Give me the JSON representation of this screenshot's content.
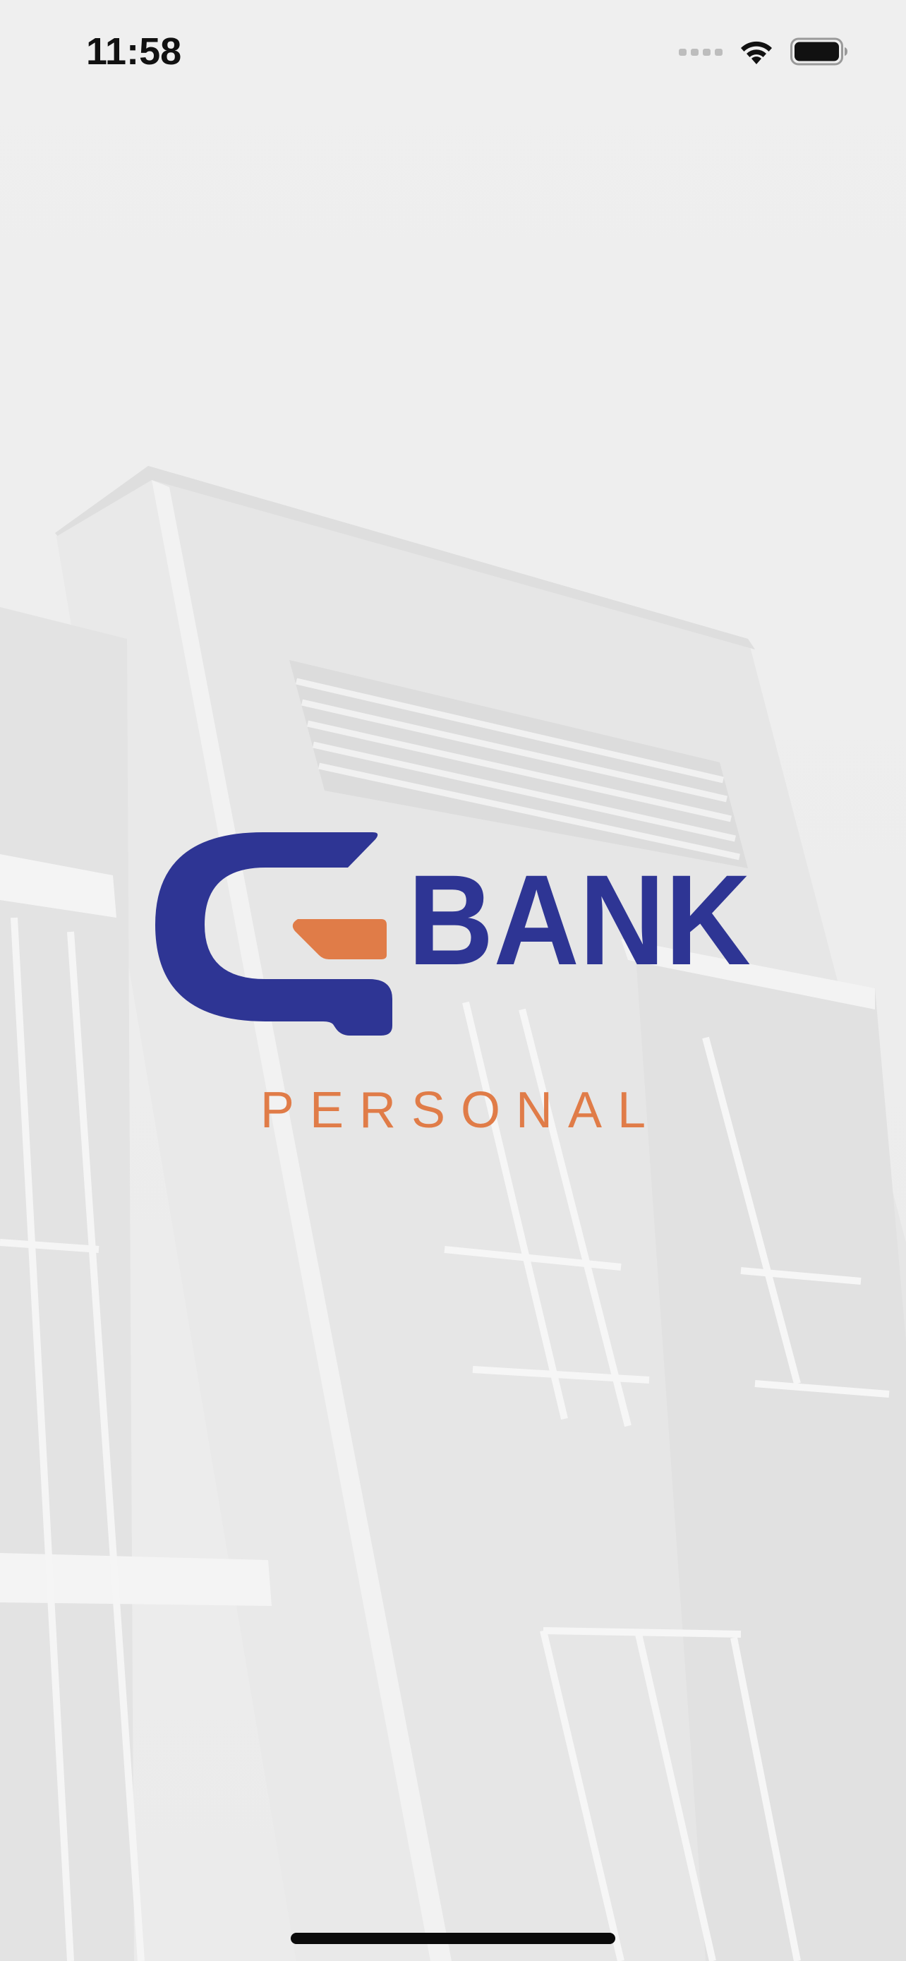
{
  "status_bar": {
    "time": "11:58",
    "icons": [
      "cellular-signal-icon",
      "wifi-icon",
      "battery-icon"
    ]
  },
  "splash": {
    "brand_word": "BANK",
    "tagline": "PERSONAL",
    "logo_icon": "g-bank-logo-icon"
  },
  "colors": {
    "brand_blue": "#2e3594",
    "brand_orange": "#e07c48",
    "background": "#efefef"
  }
}
